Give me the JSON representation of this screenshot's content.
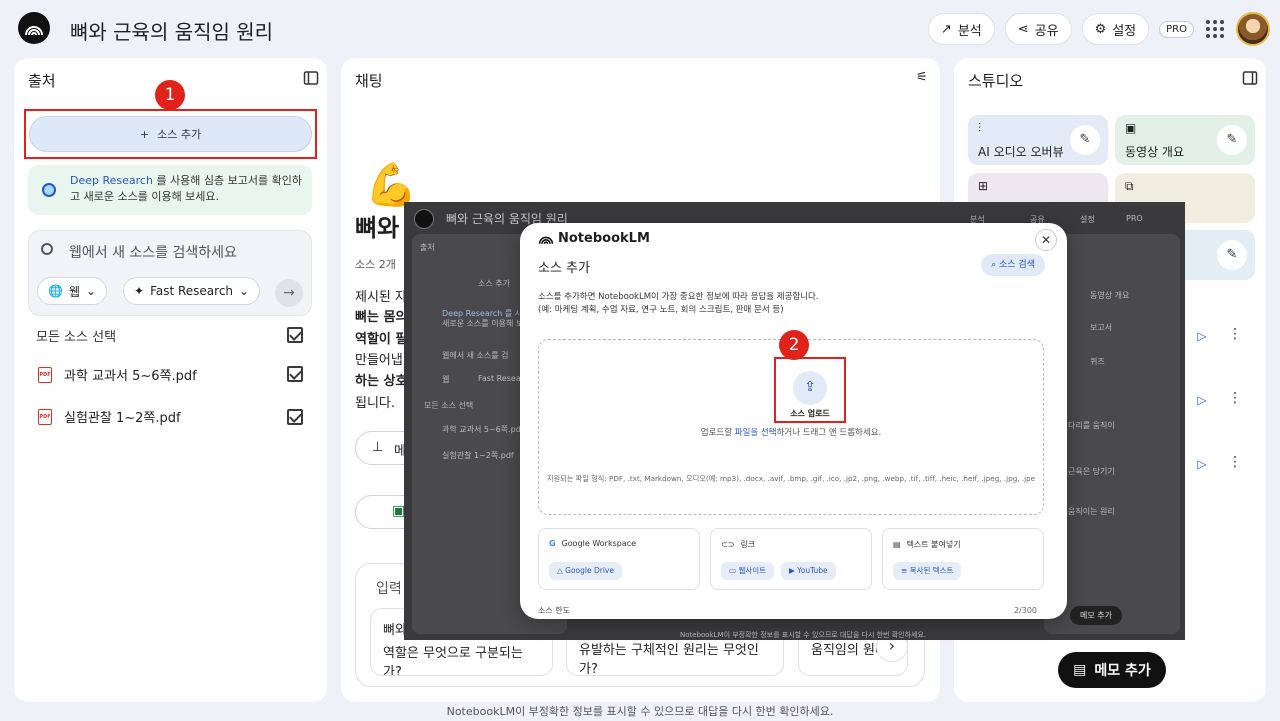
{
  "header": {
    "title": "뼈와 근육의 움직임 원리",
    "analyze_label": "분석",
    "share_label": "공유",
    "settings_label": "설정",
    "pro_label": "PRO"
  },
  "sources": {
    "title": "출처",
    "add_source_label": "소스 추가",
    "callout_number_1": "1",
    "deep_research_link": "Deep Research",
    "deep_research_text": " 를 사용해 심층 보고서를 확인하고 새로운 소스를 이용해 보세요.",
    "search_placeholder": "웹에서 새 소스를 검색하세요",
    "web_chip": "웹",
    "fast_research_chip": "Fast Research",
    "select_all_label": "모든 소스 선택",
    "items": [
      {
        "name": "과학 교과서 5~6쪽.pdf",
        "checked": true
      },
      {
        "name": "실험관찰 1~2쪽.pdf",
        "checked": true
      }
    ]
  },
  "chat": {
    "title": "채팅",
    "notebook_title_partial": "뼈와",
    "source_count": "소스 2개",
    "line1": "제시된 자",
    "line2": "뼈는 몸의",
    "line3": "역할이 필",
    "line4": "만들어냅",
    "line5": "하는 상호",
    "line6": "됩니다.",
    "pin_label": "메",
    "input_label": "입력",
    "suggestions": [
      {
        "line1": "뼈와",
        "line2": "역할은 무엇으로 구분되는가?"
      },
      {
        "line1": "",
        "line2": "유발하는 구체적인 원리는 무엇인가?"
      },
      {
        "line1": "",
        "line2": "움직임의 원리"
      }
    ]
  },
  "studio": {
    "title": "스튜디오",
    "tiles": [
      {
        "label": "AI 오디오 오버뷰",
        "color": "#e3ebf7"
      },
      {
        "label": "동영상 개요",
        "color": "#e2f0e6"
      },
      {
        "label": "",
        "color": "#ece7f0"
      },
      {
        "label": "",
        "color": "#efeee0"
      },
      {
        "label": "",
        "color": "#e3edf5"
      }
    ],
    "add_note_label": "메모 추가"
  },
  "overlay": {
    "title": "뼈와 근육의 움직임 원리",
    "sources_label": "출처",
    "add_source_label": "소스 추가",
    "deep_research_text": "Deep Research 를 사용해",
    "deep_research_text2": "새로운 소스를 이용해 보세",
    "search_text": "웹에서 새 소스를 검",
    "web_chip": "웹",
    "fast_chip": "Fast Resea",
    "select_all": "모든 소스 선택",
    "src1": "과학 교과서 5~6쪽.pdf",
    "src2": "실험관찰 1~2쪽.pdf",
    "analyze": "분석",
    "share": "공유",
    "settings": "설정",
    "pro": "PRO",
    "video_overview": "동영상 개요",
    "report": "보고서",
    "quiz": "퀴즈",
    "memo_add": "메모 추가",
    "studio_item1": "다리를 움직이",
    "studio_item2": "근육은 당기기",
    "studio_item3": "움직이는 원리",
    "footer_text": "NotebookLM이 부정확한 정보를 표시할 수 있으므로 대답을 다시 한번 확인하세요."
  },
  "dialog": {
    "brand": "NotebookLM",
    "heading": "소스 추가",
    "search_sources_label": "소스 검색",
    "description": "소스를 추가하면 NotebookLM이 가장 중요한 정보에 따라 응답을 제공합니다.\n(예: 마케팅 계획, 수업 자료, 연구 노트, 회의 스크립트, 판매 문서 등)",
    "callout_number_2": "2",
    "upload_label": "소스 업로드",
    "drop_text_before": "업로드할 ",
    "drop_link": "파일을 선택",
    "drop_text_after": "하거나 드래그 앤 드롭하세요.",
    "formats": "지원되는 파일 형식: PDF, .txt, Markdown, 오디오(예: mp3), .docx, .avif, .bmp, .gif, .ico, .jp2, .png, .webp, .tif, .tiff, .heic, .heif, .jpeg, .jpg, .jpe",
    "options": [
      {
        "title": "Google Workspace",
        "chips": [
          "Google Drive"
        ]
      },
      {
        "title": "링크",
        "chips": [
          "웹사이트",
          "YouTube"
        ]
      },
      {
        "title": "텍스트 붙여넣기",
        "chips": [
          "복사된 텍스트"
        ]
      }
    ],
    "footer_left": "소스 한도",
    "footer_right": "2/300"
  },
  "footer": {
    "disclaimer": "NotebookLM이 부정확한 정보를 표시할 수 있으므로 대답을 다시 한번 확인하세요."
  }
}
